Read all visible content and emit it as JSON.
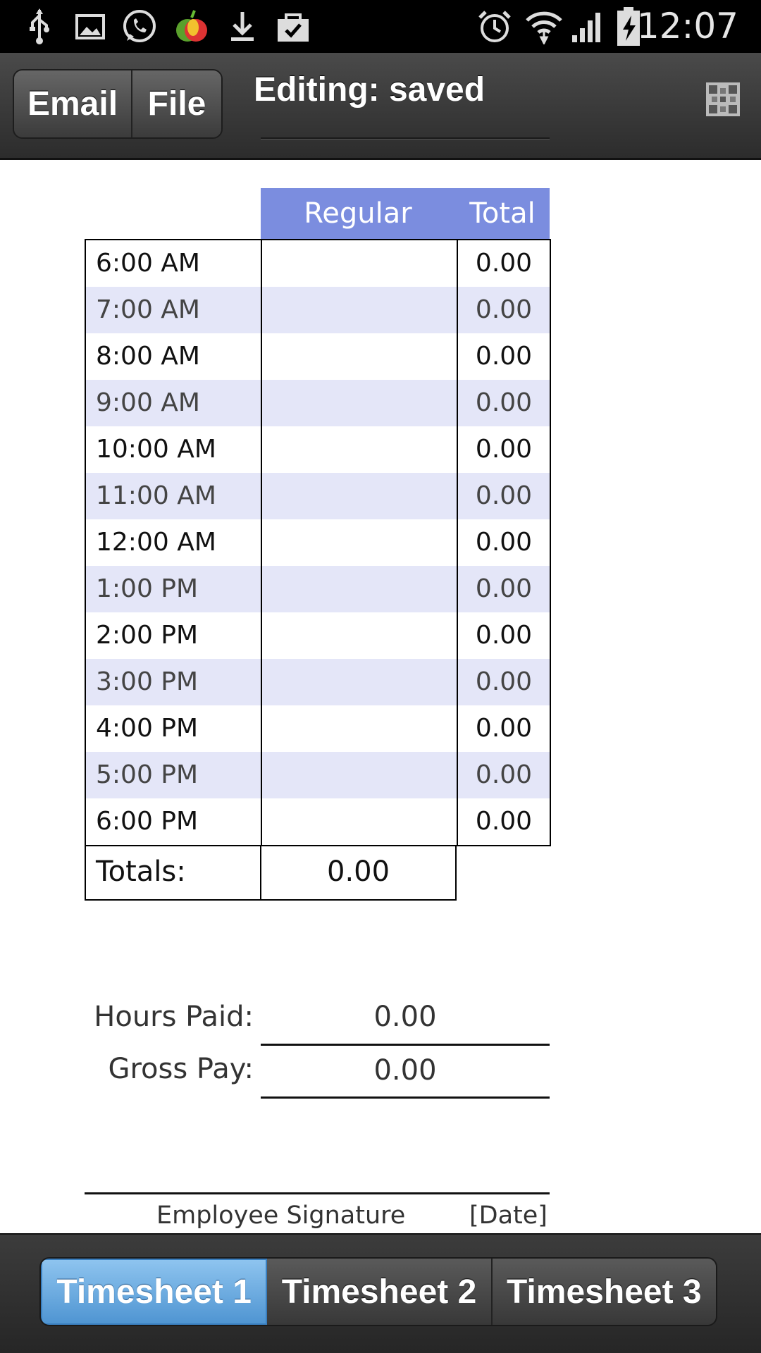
{
  "status_bar": {
    "time": "12:07",
    "left_icons": [
      "usb-icon",
      "image-icon",
      "whatsapp-icon",
      "fruit-app-icon",
      "download-icon",
      "bag-check-icon"
    ],
    "right_icons": [
      "alarm-icon",
      "wifi-icon",
      "signal-icon",
      "battery-charging-icon"
    ]
  },
  "header": {
    "email_label": "Email",
    "file_label": "File",
    "title": "Editing: saved",
    "menu_icon": "qr-grid-icon"
  },
  "table": {
    "columns": [
      "Regular",
      "Total"
    ],
    "rows": [
      {
        "time": "6:00 AM",
        "regular": "",
        "total": "0.00"
      },
      {
        "time": "7:00 AM",
        "regular": "",
        "total": "0.00"
      },
      {
        "time": "8:00 AM",
        "regular": "",
        "total": "0.00"
      },
      {
        "time": "9:00 AM",
        "regular": "",
        "total": "0.00"
      },
      {
        "time": "10:00 AM",
        "regular": "",
        "total": "0.00"
      },
      {
        "time": "11:00 AM",
        "regular": "",
        "total": "0.00"
      },
      {
        "time": "12:00 AM",
        "regular": "",
        "total": "0.00"
      },
      {
        "time": "1:00 PM",
        "regular": "",
        "total": "0.00"
      },
      {
        "time": "2:00 PM",
        "regular": "",
        "total": "0.00"
      },
      {
        "time": "3:00 PM",
        "regular": "",
        "total": "0.00"
      },
      {
        "time": "4:00 PM",
        "regular": "",
        "total": "0.00"
      },
      {
        "time": "5:00 PM",
        "regular": "",
        "total": "0.00"
      },
      {
        "time": "6:00 PM",
        "regular": "",
        "total": "0.00"
      }
    ],
    "totals_label": "Totals:",
    "totals_regular": "0.00"
  },
  "pay": {
    "hours_paid_label": "Hours Paid:",
    "hours_paid_value": "0.00",
    "gross_pay_label": "Gross Pay:",
    "gross_pay_value": "0.00"
  },
  "signature": {
    "employee_label": "Employee Signature",
    "date_label": "[Date]"
  },
  "tabs": [
    {
      "label": "Timesheet 1",
      "active": true
    },
    {
      "label": "Timesheet 2",
      "active": false
    },
    {
      "label": "Timesheet 3",
      "active": false
    }
  ],
  "colors": {
    "header_accent": "#7b8ddf",
    "alt_row": "#e4e6f8",
    "active_tab": "#5fa3dd"
  }
}
